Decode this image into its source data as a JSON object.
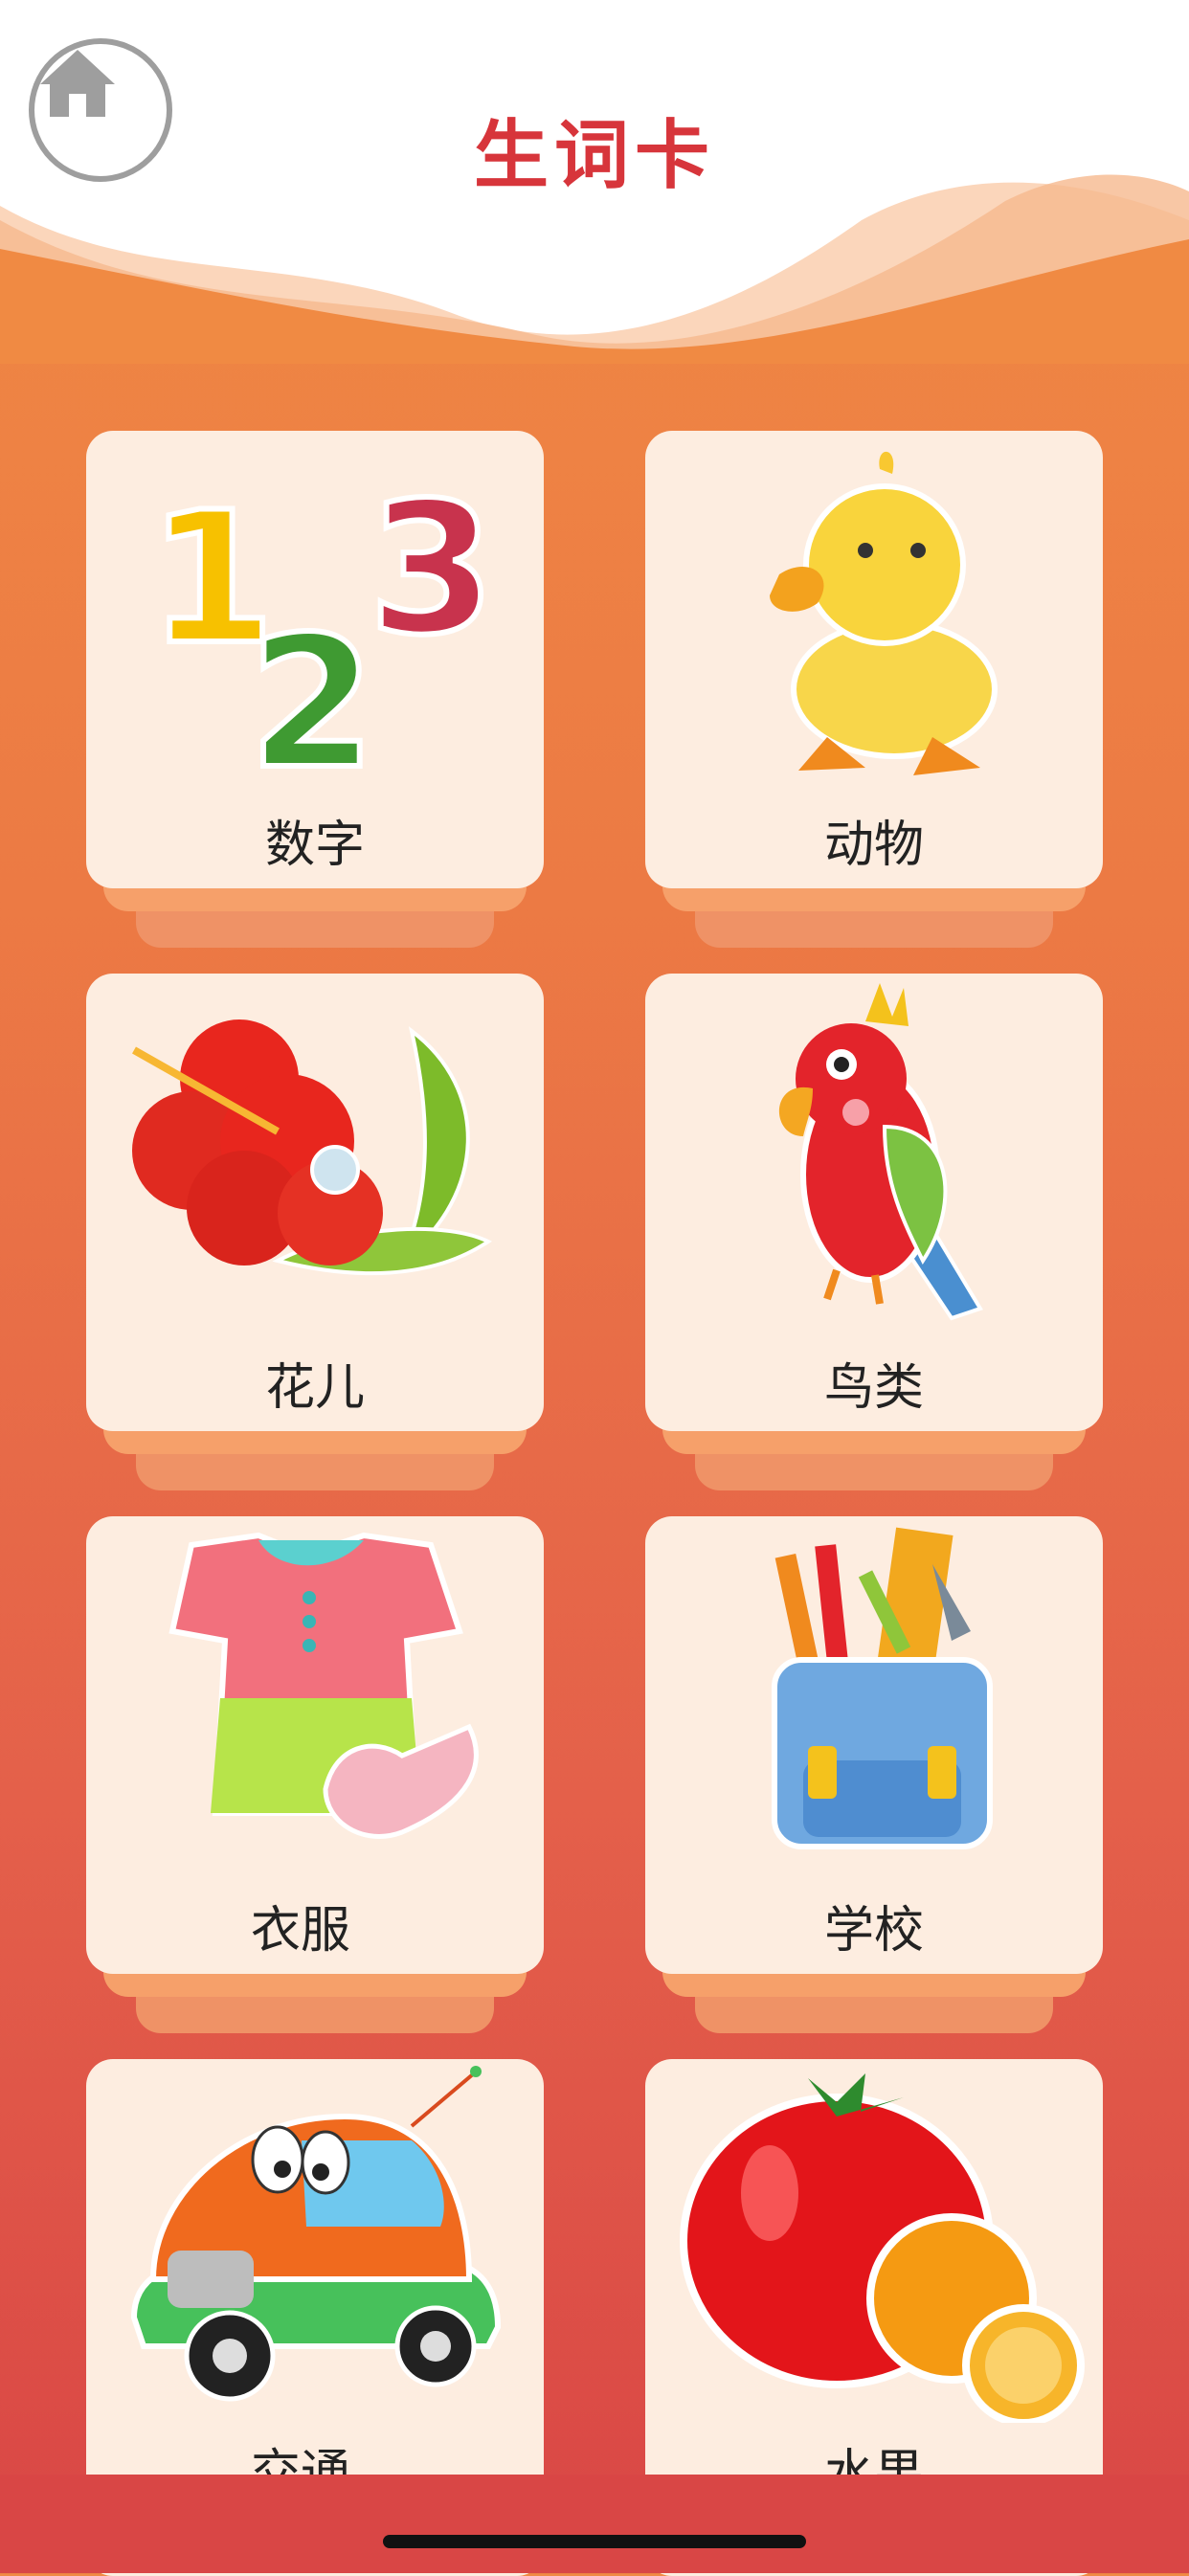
{
  "header": {
    "title": "生词卡",
    "home_icon": "home-icon",
    "accent_color": "#d7353b"
  },
  "categories": [
    {
      "label": "数字",
      "icon": "numbers-123-icon"
    },
    {
      "label": "动物",
      "icon": "duck-icon"
    },
    {
      "label": "花儿",
      "icon": "hibiscus-flower-icon"
    },
    {
      "label": "鸟类",
      "icon": "parrot-icon"
    },
    {
      "label": "衣服",
      "icon": "dress-socks-icon"
    },
    {
      "label": "学校",
      "icon": "school-bag-icon"
    },
    {
      "label": "交通",
      "icon": "toy-car-icon"
    },
    {
      "label": "水果",
      "icon": "tomato-orange-icon"
    }
  ]
}
